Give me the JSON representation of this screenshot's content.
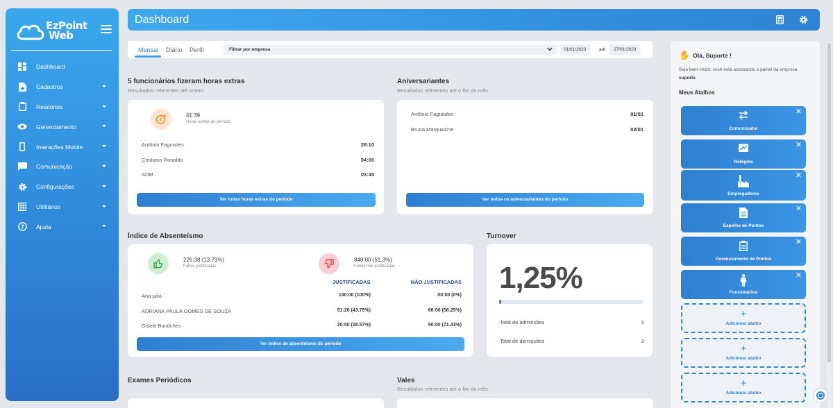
{
  "sidebar": {
    "logo_line1": "EzPoint",
    "logo_line2": "Web",
    "items": [
      {
        "label": "Dashboard",
        "icon": "dashboard-icon"
      },
      {
        "label": "Cadastros",
        "icon": "file-plus-icon"
      },
      {
        "label": "Relatórios",
        "icon": "clipboard-icon"
      },
      {
        "label": "Gerenciamento",
        "icon": "eye-icon"
      },
      {
        "label": "Interações Mobile",
        "icon": "mobile-icon"
      },
      {
        "label": "Comunicação",
        "icon": "chat-icon"
      },
      {
        "label": "Configurações",
        "icon": "gear-icon"
      },
      {
        "label": "Utilitários",
        "icon": "grid-icon"
      },
      {
        "label": "Ajuda",
        "icon": "help-icon"
      }
    ]
  },
  "header": {
    "title": "Dashboard"
  },
  "filters": {
    "tabs": [
      "Mensal",
      "Diário",
      "Perfil"
    ],
    "company_placeholder": "Filtrar por empresa",
    "date_from": "01/01/2023",
    "until_label": "até",
    "date_to": "27/01/2023"
  },
  "overtime": {
    "title": "5 funcionários fizeram horas extras",
    "subtitle": "Resultados referentes até ontem",
    "total_value": "41:39",
    "total_label": "Horas extras do período",
    "rows": [
      {
        "name": "Antônio Fagundes",
        "value": "28:10"
      },
      {
        "name": "Cristiano Ronaldo",
        "value": "04:00"
      },
      {
        "name": "ADM",
        "value": "03:45"
      }
    ],
    "button": "Ver todas horas extras do período"
  },
  "birthdays": {
    "title": "Aniversariantes",
    "subtitle": "Resultados referentes até o fim do mês",
    "rows": [
      {
        "name": "Antônio Fagundes",
        "value": "01/01"
      },
      {
        "name": "Bruna Marquezine",
        "value": "02/01"
      }
    ],
    "button": "Ver todos os aniversariantes do período"
  },
  "absenteeism": {
    "title": "Índice de Absenteísmo",
    "justified_value": "226:38 (13.71%)",
    "justified_label": "Faltas justificadas",
    "unjustified_value": "848:00 (51.3%)",
    "unjustified_label": "Faltas não justificadas",
    "col_justified": "JUSTIFICADAS",
    "col_unjustified": "NÃO JUSTIFICADAS",
    "rows": [
      {
        "name": "Ana julia",
        "justified": "140:00 (100%)",
        "unjustified": "00:00 (0%)"
      },
      {
        "name": "ADRIANA PAULA GOMES DE SOUZA",
        "justified": "51:20 (43.75%)",
        "unjustified": "66:00 (56.25%)"
      },
      {
        "name": "Gisele Bundchen",
        "justified": "20:00 (28.57%)",
        "unjustified": "50:00 (71.43%)"
      }
    ],
    "button": "Ver índice de absenteísmo do período"
  },
  "turnover": {
    "title": "Turnover",
    "value": "1,25%",
    "progress_fraction": 0.0125,
    "admissions_label": "Total de admissões",
    "admissions_value": "5",
    "dismissals_label": "Total de demissões",
    "dismissals_value": "2"
  },
  "exams": {
    "title": "Exames Periódicos"
  },
  "vales": {
    "title": "Vales",
    "subtitle": "Resultados referentes até o fim do mês"
  },
  "panel": {
    "greeting": "Olá, Suporte !",
    "welcome_text": "Seja bem-vindo, você está acessando o painel da empresa",
    "company": "suporte",
    "shortcuts_title": "Meus Atalhos",
    "shortcuts": [
      {
        "label": "Comunicador",
        "icon": "arrows-icon"
      },
      {
        "label": "Relógios",
        "icon": "clock-device-icon"
      },
      {
        "label": "Empregadores",
        "icon": "factory-icon"
      },
      {
        "label": "Espelho de Pontos",
        "icon": "document-icon"
      },
      {
        "label": "Gerenciamento de Pontos",
        "icon": "clipboard-icon"
      },
      {
        "label": "Funcionários",
        "icon": "person-icon"
      }
    ],
    "add_label": "Adicionar atalho"
  },
  "colors": {
    "accent": "#2f86d8",
    "sidebar_top": "#3aa7ec",
    "sidebar_bottom": "#2a6fc7"
  }
}
